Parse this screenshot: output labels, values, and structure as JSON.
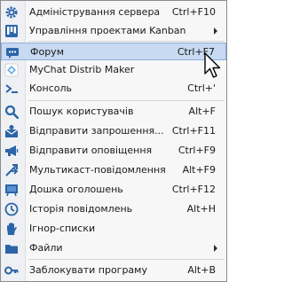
{
  "colors": {
    "highlight": "#c7daf2",
    "highlight_border": "#8fb0dc",
    "icon_blue": "#2b64a8"
  },
  "menu": {
    "items": [
      {
        "label": "Адміністрування сервера",
        "shortcut": "Ctrl+F10",
        "icon": "gear-icon"
      },
      {
        "label": "Управління проектами Kanban",
        "shortcut": "",
        "icon": "kanban-icon",
        "submenu": true
      },
      {
        "label": "Форум",
        "shortcut": "Ctrl+F7",
        "icon": "forum-icon",
        "highlighted": true
      },
      {
        "label": "MyChat Distrib Maker",
        "shortcut": "",
        "icon": "distrib-maker-icon"
      },
      {
        "label": "Консоль",
        "shortcut": "Ctrl+'",
        "icon": "console-icon"
      },
      {
        "label": "Пошук користувачів",
        "shortcut": "Alt+F",
        "icon": "search-icon"
      },
      {
        "label": "Відправити запрошення...",
        "shortcut": "Ctrl+F11",
        "icon": "invite-icon"
      },
      {
        "label": "Відправити оповіщення",
        "shortcut": "Ctrl+F9",
        "icon": "megaphone-icon"
      },
      {
        "label": "Мультикаст-повідомлення",
        "shortcut": "Alt+F9",
        "icon": "multicast-icon"
      },
      {
        "label": "Дошка оголошень",
        "shortcut": "Ctrl+F12",
        "icon": "bulletin-board-icon"
      },
      {
        "label": "Історія повідомлень",
        "shortcut": "Alt+H",
        "icon": "history-icon"
      },
      {
        "label": "Ігнор-списки",
        "shortcut": "",
        "icon": "ignore-hand-icon"
      },
      {
        "label": "Файли",
        "shortcut": "",
        "icon": "files-icon",
        "submenu": true
      },
      {
        "label": "Заблокувати програму",
        "shortcut": "Alt+B",
        "icon": "lock-key-icon"
      }
    ]
  }
}
